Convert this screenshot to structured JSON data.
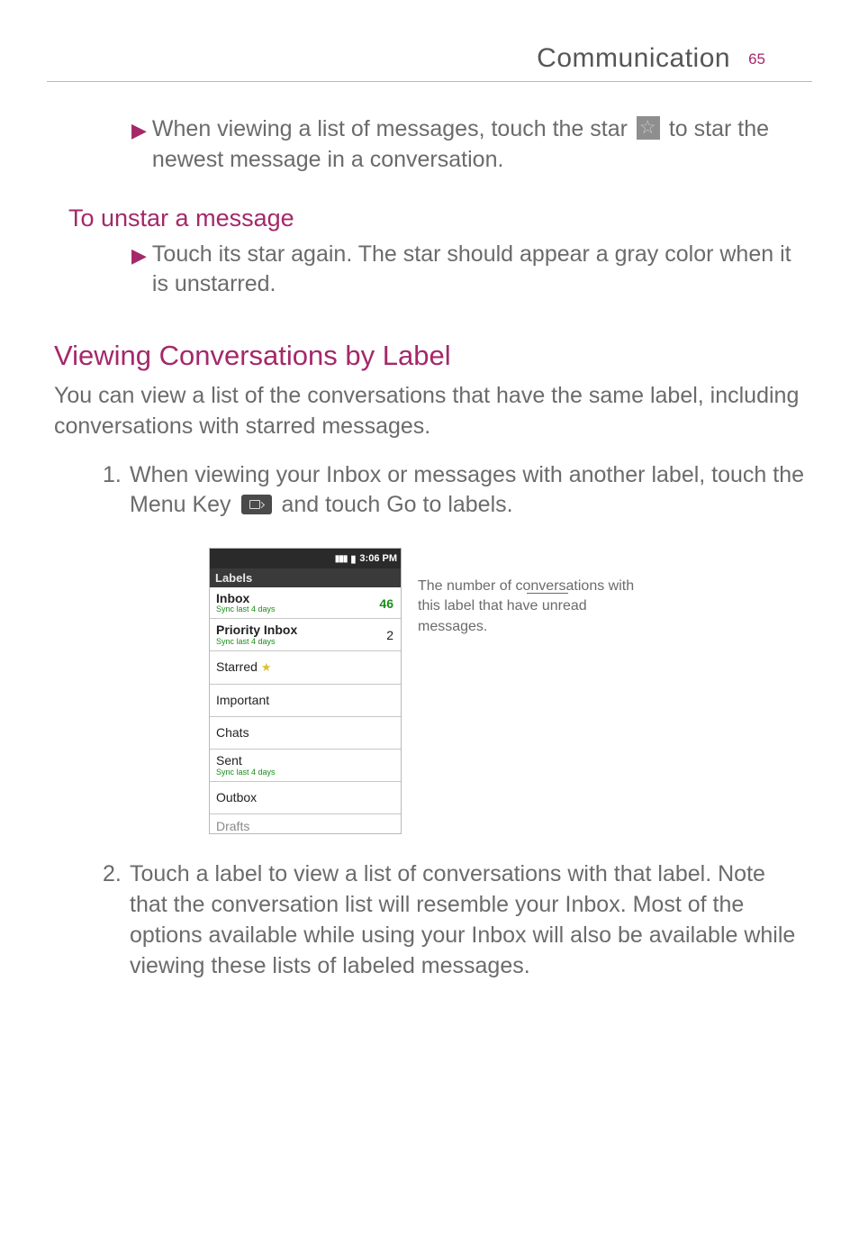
{
  "header": {
    "title": "Communication",
    "page": "65"
  },
  "bullet1_pre": "When viewing a list of messages, touch the star ",
  "bullet1_post": " to star the newest message in a conversation.",
  "h_unstar": "To unstar a message",
  "bullet2": "Touch its star again. The star should appear a gray color when it is unstarred.",
  "h_view": "Viewing Conversations by Label",
  "para_view": "You can view a list of the conversations that have the same label, including conversations with starred messages.",
  "step1_idx": "1.",
  "step1_pre": "When viewing your Inbox or messages with another label, touch the ",
  "step1_menu": "Menu Key",
  "step1_mid": " and touch ",
  "step1_goto": "Go to labels",
  "step1_end": ".",
  "status_time": "3:06 PM",
  "labels_hdr": "Labels",
  "rows": {
    "inbox": {
      "name": "Inbox",
      "sync": "Sync last 4 days",
      "count": "46"
    },
    "priority": {
      "name": "Priority Inbox",
      "sync": "Sync last 4 days",
      "count": "2"
    },
    "starred": {
      "name": "Starred"
    },
    "important": {
      "name": "Important"
    },
    "chats": {
      "name": "Chats"
    },
    "sent": {
      "name": "Sent",
      "sync": "Sync last 4 days"
    },
    "outbox": {
      "name": "Outbox"
    },
    "drafts": {
      "name": "Drafts"
    }
  },
  "callout": "The number of conversations with this label that have unread messages.",
  "step2_idx": "2.",
  "step2": "Touch a label to view a list of conversations with that label. Note that the conversation list will resemble your Inbox. Most of the options available while using your Inbox will also be available while viewing these lists of labeled messages."
}
